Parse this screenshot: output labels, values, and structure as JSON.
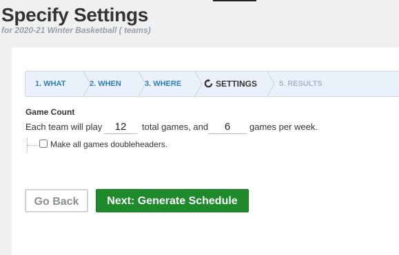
{
  "header": {
    "title": "Specify Settings",
    "subtitle": "for 2020-21 Winter Basketball ( teams)"
  },
  "steps": [
    {
      "label": "1. WHAT",
      "state": "done"
    },
    {
      "label": "2. WHEN",
      "state": "done"
    },
    {
      "label": "3. WHERE",
      "state": "done"
    },
    {
      "label": "SETTINGS",
      "state": "active",
      "icon": "spinner-icon"
    },
    {
      "label": "5. RESULTS",
      "state": "disabled"
    }
  ],
  "game_count": {
    "section_label": "Game Count",
    "prefix": "Each team will play",
    "total_games": "12",
    "middle": "total games, and",
    "per_week": "6",
    "suffix": "games per week."
  },
  "doubleheader": {
    "label": "Make all games doubleheaders.",
    "checked": false
  },
  "buttons": {
    "back": "Go Back",
    "next": "Next: Generate Schedule"
  },
  "colors": {
    "step_link": "#2e7dc2",
    "step_disabled": "#a9b7c6",
    "primary_button": "#1e8a2c"
  }
}
